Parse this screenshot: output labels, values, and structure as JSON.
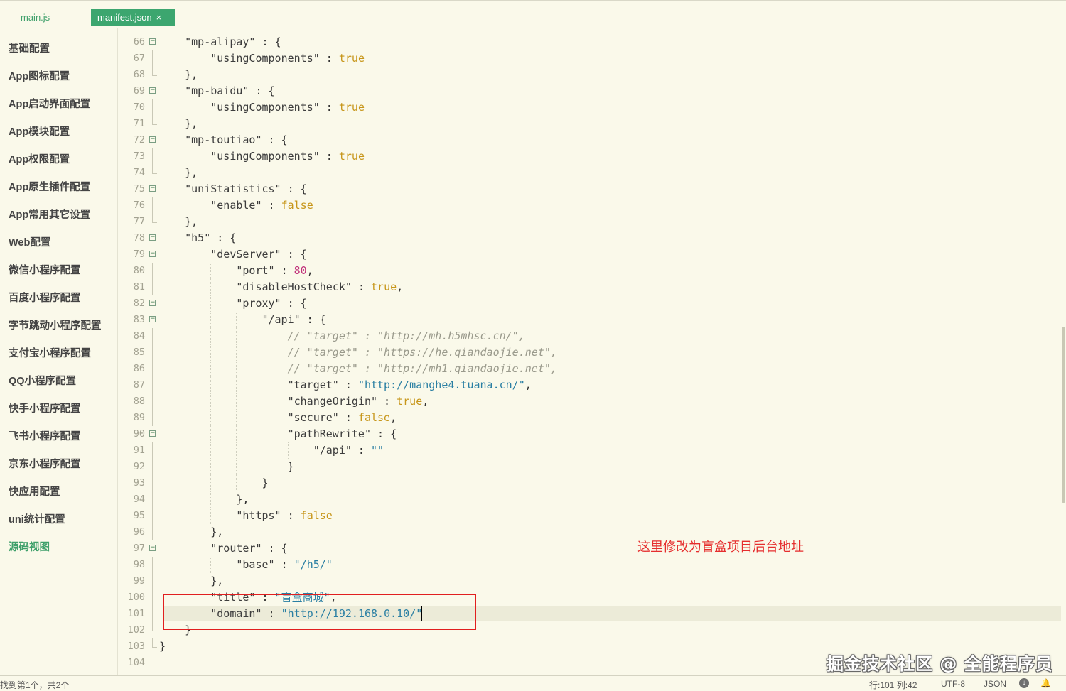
{
  "tabs": [
    {
      "label": "main.js"
    },
    {
      "label": "manifest.json",
      "close": "×"
    }
  ],
  "sidebar": {
    "items": [
      {
        "label": "基础配置"
      },
      {
        "label": "App图标配置"
      },
      {
        "label": "App启动界面配置"
      },
      {
        "label": "App模块配置"
      },
      {
        "label": "App权限配置"
      },
      {
        "label": "App原生插件配置"
      },
      {
        "label": "App常用其它设置"
      },
      {
        "label": "Web配置"
      },
      {
        "label": "微信小程序配置"
      },
      {
        "label": "百度小程序配置"
      },
      {
        "label": "字节跳动小程序配置"
      },
      {
        "label": "支付宝小程序配置"
      },
      {
        "label": "QQ小程序配置"
      },
      {
        "label": "快手小程序配置"
      },
      {
        "label": "飞书小程序配置"
      },
      {
        "label": "京东小程序配置"
      },
      {
        "label": "快应用配置"
      },
      {
        "label": "uni统计配置"
      },
      {
        "label": "源码视图",
        "active": true
      }
    ]
  },
  "editor": {
    "lines": [
      {
        "n": "66",
        "fold": "start",
        "indent": 1,
        "tokens": [
          [
            "k",
            "\"mp-alipay\""
          ],
          [
            "p",
            " : {"
          ]
        ]
      },
      {
        "n": "67",
        "fold": "line",
        "indent": 2,
        "tokens": [
          [
            "k",
            "\"usingComponents\""
          ],
          [
            "p",
            " : "
          ],
          [
            "b",
            "true"
          ]
        ]
      },
      {
        "n": "68",
        "fold": "end",
        "indent": 1,
        "tokens": [
          [
            "p",
            "},"
          ]
        ]
      },
      {
        "n": "69",
        "fold": "start",
        "indent": 1,
        "tokens": [
          [
            "k",
            "\"mp-baidu\""
          ],
          [
            "p",
            " : {"
          ]
        ]
      },
      {
        "n": "70",
        "fold": "line",
        "indent": 2,
        "tokens": [
          [
            "k",
            "\"usingComponents\""
          ],
          [
            "p",
            " : "
          ],
          [
            "b",
            "true"
          ]
        ]
      },
      {
        "n": "71",
        "fold": "end",
        "indent": 1,
        "tokens": [
          [
            "p",
            "},"
          ]
        ]
      },
      {
        "n": "72",
        "fold": "start",
        "indent": 1,
        "tokens": [
          [
            "k",
            "\"mp-toutiao\""
          ],
          [
            "p",
            " : {"
          ]
        ]
      },
      {
        "n": "73",
        "fold": "line",
        "indent": 2,
        "tokens": [
          [
            "k",
            "\"usingComponents\""
          ],
          [
            "p",
            " : "
          ],
          [
            "b",
            "true"
          ]
        ]
      },
      {
        "n": "74",
        "fold": "end",
        "indent": 1,
        "tokens": [
          [
            "p",
            "},"
          ]
        ]
      },
      {
        "n": "75",
        "fold": "start",
        "indent": 1,
        "tokens": [
          [
            "k",
            "\"uniStatistics\""
          ],
          [
            "p",
            " : {"
          ]
        ]
      },
      {
        "n": "76",
        "fold": "line",
        "indent": 2,
        "tokens": [
          [
            "k",
            "\"enable\""
          ],
          [
            "p",
            " : "
          ],
          [
            "b",
            "false"
          ]
        ]
      },
      {
        "n": "77",
        "fold": "end",
        "indent": 1,
        "tokens": [
          [
            "p",
            "},"
          ]
        ]
      },
      {
        "n": "78",
        "fold": "start",
        "indent": 1,
        "tokens": [
          [
            "k",
            "\"h5\""
          ],
          [
            "p",
            " : {"
          ]
        ]
      },
      {
        "n": "79",
        "fold": "start",
        "indent": 2,
        "tokens": [
          [
            "k",
            "\"devServer\""
          ],
          [
            "p",
            " : {"
          ]
        ]
      },
      {
        "n": "80",
        "fold": "line",
        "indent": 3,
        "tokens": [
          [
            "k",
            "\"port\""
          ],
          [
            "p",
            " : "
          ],
          [
            "n",
            "80"
          ],
          [
            "p",
            ","
          ]
        ]
      },
      {
        "n": "81",
        "fold": "line",
        "indent": 3,
        "tokens": [
          [
            "k",
            "\"disableHostCheck\""
          ],
          [
            "p",
            " : "
          ],
          [
            "b",
            "true"
          ],
          [
            "p",
            ","
          ]
        ]
      },
      {
        "n": "82",
        "fold": "start",
        "indent": 3,
        "tokens": [
          [
            "k",
            "\"proxy\""
          ],
          [
            "p",
            " : {"
          ]
        ]
      },
      {
        "n": "83",
        "fold": "start",
        "indent": 4,
        "tokens": [
          [
            "k",
            "\"/api\""
          ],
          [
            "p",
            " : {"
          ]
        ]
      },
      {
        "n": "84",
        "fold": "line",
        "indent": 5,
        "tokens": [
          [
            "c",
            "// \"target\" : \"http://mh.h5mhsc.cn/\","
          ]
        ]
      },
      {
        "n": "85",
        "fold": "line",
        "indent": 5,
        "tokens": [
          [
            "c",
            "// \"target\" : \"https://he.qiandaojie.net\","
          ]
        ]
      },
      {
        "n": "86",
        "fold": "line",
        "indent": 5,
        "tokens": [
          [
            "c",
            "// \"target\" : \"http://mh1.qiandaojie.net\","
          ]
        ]
      },
      {
        "n": "87",
        "fold": "line",
        "indent": 5,
        "tokens": [
          [
            "k",
            "\"target\""
          ],
          [
            "p",
            " : "
          ],
          [
            "s",
            "\"http://manghe4.tuana.cn/\""
          ],
          [
            "p",
            ","
          ]
        ]
      },
      {
        "n": "88",
        "fold": "line",
        "indent": 5,
        "tokens": [
          [
            "k",
            "\"changeOrigin\""
          ],
          [
            "p",
            " : "
          ],
          [
            "b",
            "true"
          ],
          [
            "p",
            ","
          ]
        ]
      },
      {
        "n": "89",
        "fold": "line",
        "indent": 5,
        "tokens": [
          [
            "k",
            "\"secure\""
          ],
          [
            "p",
            " : "
          ],
          [
            "b",
            "false"
          ],
          [
            "p",
            ","
          ]
        ]
      },
      {
        "n": "90",
        "fold": "start",
        "indent": 5,
        "tokens": [
          [
            "k",
            "\"pathRewrite\""
          ],
          [
            "p",
            " : {"
          ]
        ]
      },
      {
        "n": "91",
        "fold": "line",
        "indent": 6,
        "tokens": [
          [
            "k",
            "\"/api\""
          ],
          [
            "p",
            " : "
          ],
          [
            "s",
            "\"\""
          ]
        ]
      },
      {
        "n": "92",
        "fold": "line",
        "indent": 5,
        "tokens": [
          [
            "p",
            "}"
          ]
        ]
      },
      {
        "n": "93",
        "fold": "line",
        "indent": 4,
        "tokens": [
          [
            "p",
            "}"
          ]
        ]
      },
      {
        "n": "94",
        "fold": "line",
        "indent": 3,
        "tokens": [
          [
            "p",
            "},"
          ]
        ]
      },
      {
        "n": "95",
        "fold": "line",
        "indent": 3,
        "tokens": [
          [
            "k",
            "\"https\""
          ],
          [
            "p",
            " : "
          ],
          [
            "b",
            "false"
          ]
        ]
      },
      {
        "n": "96",
        "fold": "line",
        "indent": 2,
        "tokens": [
          [
            "p",
            "},"
          ]
        ]
      },
      {
        "n": "97",
        "fold": "start",
        "indent": 2,
        "tokens": [
          [
            "k",
            "\"router\""
          ],
          [
            "p",
            " : {"
          ]
        ]
      },
      {
        "n": "98",
        "fold": "line",
        "indent": 3,
        "tokens": [
          [
            "k",
            "\"base\""
          ],
          [
            "p",
            " : "
          ],
          [
            "s",
            "\"/h5/\""
          ]
        ]
      },
      {
        "n": "99",
        "fold": "line",
        "indent": 2,
        "tokens": [
          [
            "p",
            "},"
          ]
        ]
      },
      {
        "n": "100",
        "fold": "line",
        "indent": 2,
        "tokens": [
          [
            "k",
            "\"title\""
          ],
          [
            "p",
            " : "
          ],
          [
            "s",
            "\"盲盒商城\""
          ],
          [
            "p",
            ","
          ]
        ]
      },
      {
        "n": "101",
        "fold": "line",
        "indent": 2,
        "current": true,
        "tokens": [
          [
            "k",
            "\"domain\""
          ],
          [
            "p",
            " : "
          ],
          [
            "s",
            "\"http://192.168.0.10/\""
          ]
        ]
      },
      {
        "n": "102",
        "fold": "end",
        "indent": 1,
        "tokens": [
          [
            "p",
            "}"
          ]
        ]
      },
      {
        "n": "103",
        "fold": "end",
        "indent": 0,
        "tokens": [
          [
            "p",
            "}"
          ]
        ]
      },
      {
        "n": "104",
        "fold": "none",
        "indent": 0,
        "tokens": []
      }
    ]
  },
  "annotation": "这里修改为盲盒项目后台地址",
  "watermark": "掘金技术社区 @ 全能程序员",
  "status": {
    "find": "找到第1个，共2个",
    "position": "行:101   列:42",
    "encoding": "UTF-8",
    "language": "JSON"
  },
  "icons": {
    "download": "download-icon",
    "bell": "bell-icon",
    "fold": "fold-toggle-icon",
    "close": "close-icon"
  },
  "colors": {
    "background": "#faf9ea",
    "accent": "#3ca66f",
    "string": "#2a7fa3",
    "boolean": "#c7961a",
    "number": "#c0307a",
    "comment": "#9a9a8c",
    "annotation": "#e52e2e"
  }
}
